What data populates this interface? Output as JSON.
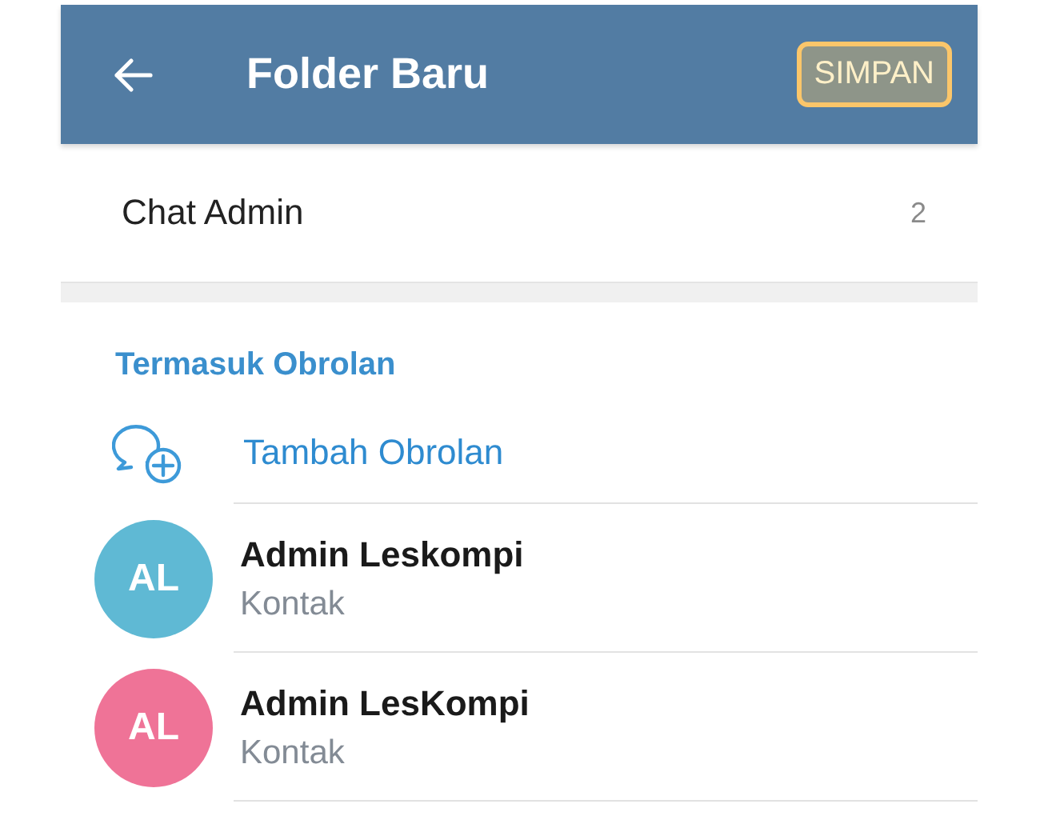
{
  "header": {
    "title": "Folder Baru",
    "save_button": {
      "label": "SIMPAN",
      "highlighted": true
    }
  },
  "folder_name": {
    "value": "Chat Admin",
    "count": "2"
  },
  "section": {
    "title": "Termasuk Obrolan",
    "add_label": "Tambah Obrolan"
  },
  "chats": [
    {
      "initials": "AL",
      "name": "Admin Leskompi",
      "subtitle": "Kontak",
      "color": "#5fb9d4"
    },
    {
      "initials": "AL",
      "name": "Admin LesKompi",
      "subtitle": "Kontak",
      "color": "#ef7397"
    }
  ]
}
